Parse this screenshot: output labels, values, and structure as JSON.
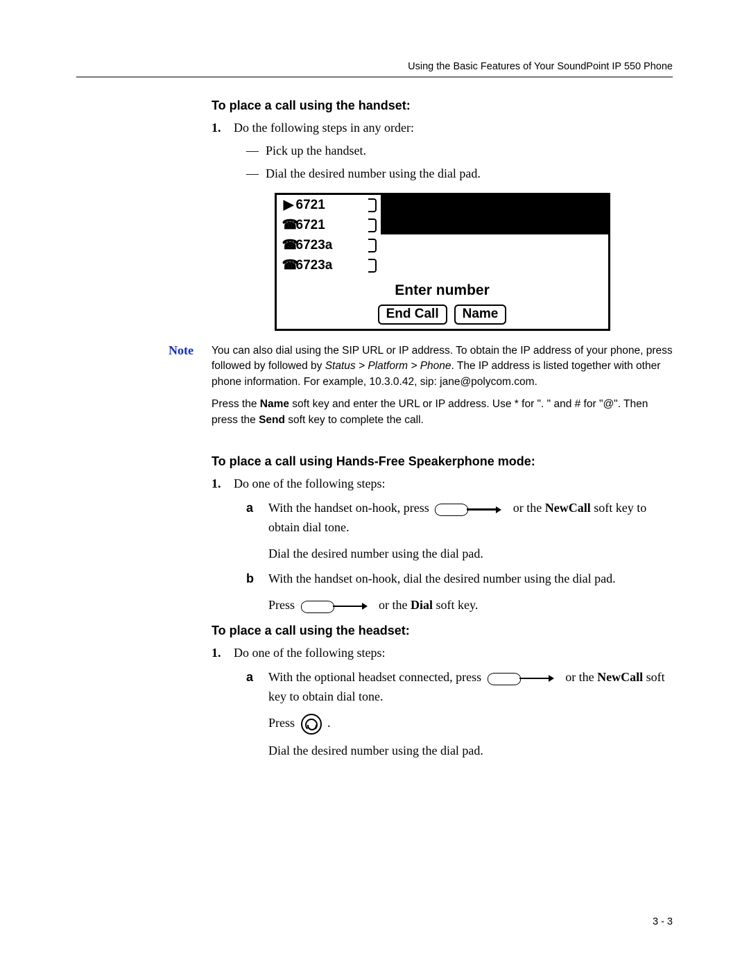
{
  "header": {
    "running_head": "Using the Basic Features of Your SoundPoint IP 550 Phone"
  },
  "page_number": "3 - 3",
  "section1": {
    "title": "To place a call using the handset:",
    "step1_marker": "1.",
    "step1_text": "Do the following steps in any order:",
    "bullet1": "Pick up the handset.",
    "bullet2": "Dial the desired number using the dial pad."
  },
  "lcd": {
    "lines": [
      {
        "icon": "◀",
        "label": "6721"
      },
      {
        "icon": "☎",
        "label": "6721"
      },
      {
        "icon": "☎",
        "label": "6723a"
      },
      {
        "icon": "☎",
        "label": "6723a"
      }
    ],
    "message": "Enter number",
    "softkeys": [
      "End Call",
      "Name"
    ]
  },
  "note": {
    "label": "Note",
    "p1_a": "You can also dial using the SIP URL or IP address. To obtain the IP address of your phone, press followed by followed by ",
    "p1_italic": "Status > Platform > Phone",
    "p1_b": ". The IP address is listed together with other phone information. For example, 10.3.0.42, sip: jane@polycom.com.",
    "p2_a": "Press the ",
    "p2_bold1": "Name",
    "p2_b": " soft key and enter the URL or IP address. Use * for \". \" and # for \"@\". Then press the ",
    "p2_bold2": "Send",
    "p2_c": " soft key to complete the call."
  },
  "section2": {
    "title": "To place a call using Hands-Free Speakerphone mode:",
    "step1_marker": "1.",
    "step1_text": "Do one of the following steps:",
    "a_marker": "a",
    "a_text1": "With the handset on-hook, press ",
    "a_text2": " or the ",
    "a_bold": "NewCall",
    "a_text3": " soft key to obtain dial tone.",
    "a_para": "Dial the desired number using the dial pad.",
    "b_marker": "b",
    "b_text": "With the handset on-hook, dial the desired number using the dial pad.",
    "b_para1": "Press ",
    "b_para2": " or the ",
    "b_bold": "Dial",
    "b_para3": " soft key."
  },
  "section3": {
    "title": "To place a call using the headset:",
    "step1_marker": "1.",
    "step1_text": "Do one of the following steps:",
    "a_marker": "a",
    "a_text1": "With the optional headset connected, press ",
    "a_text2": " or the ",
    "a_bold": "NewCall",
    "a_text3": " soft key to obtain dial tone.",
    "a_press": "Press ",
    "a_period": " .",
    "a_para": "Dial the desired number using the dial pad."
  }
}
